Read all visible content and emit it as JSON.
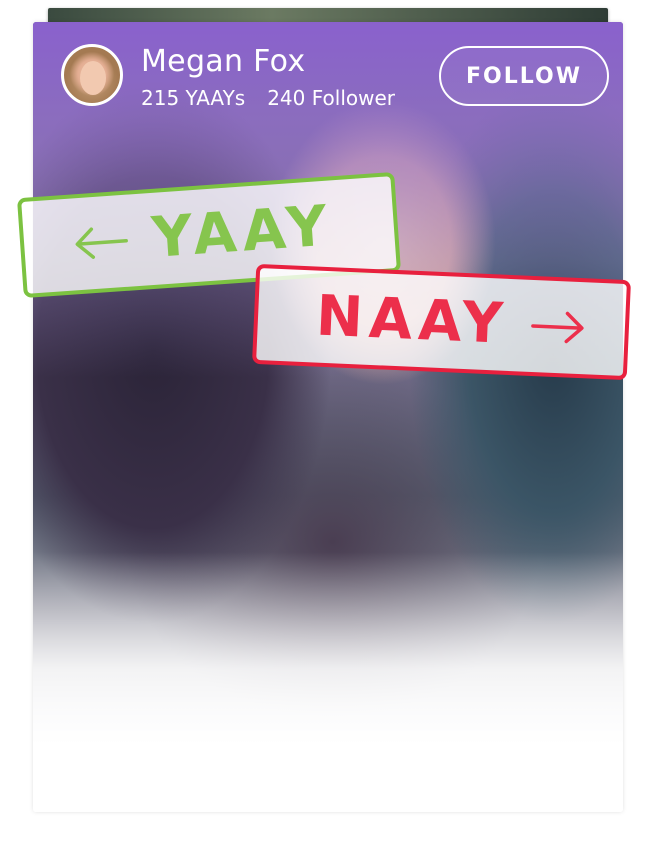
{
  "profile": {
    "name": "Megan Fox",
    "yaays": "215 YAAYs",
    "followers": "240 Follower"
  },
  "actions": {
    "follow_label": "FOLLOW"
  },
  "stamps": {
    "yaay_label": "YAAY",
    "naay_label": "NAAY"
  },
  "icons": {
    "left": "arrow-left-icon",
    "right": "arrow-right-icon"
  },
  "colors": {
    "header_tint": "#8c62d2",
    "yaay": "#7cc241",
    "naay": "#e8203e",
    "text_on_header": "#ffffff"
  }
}
